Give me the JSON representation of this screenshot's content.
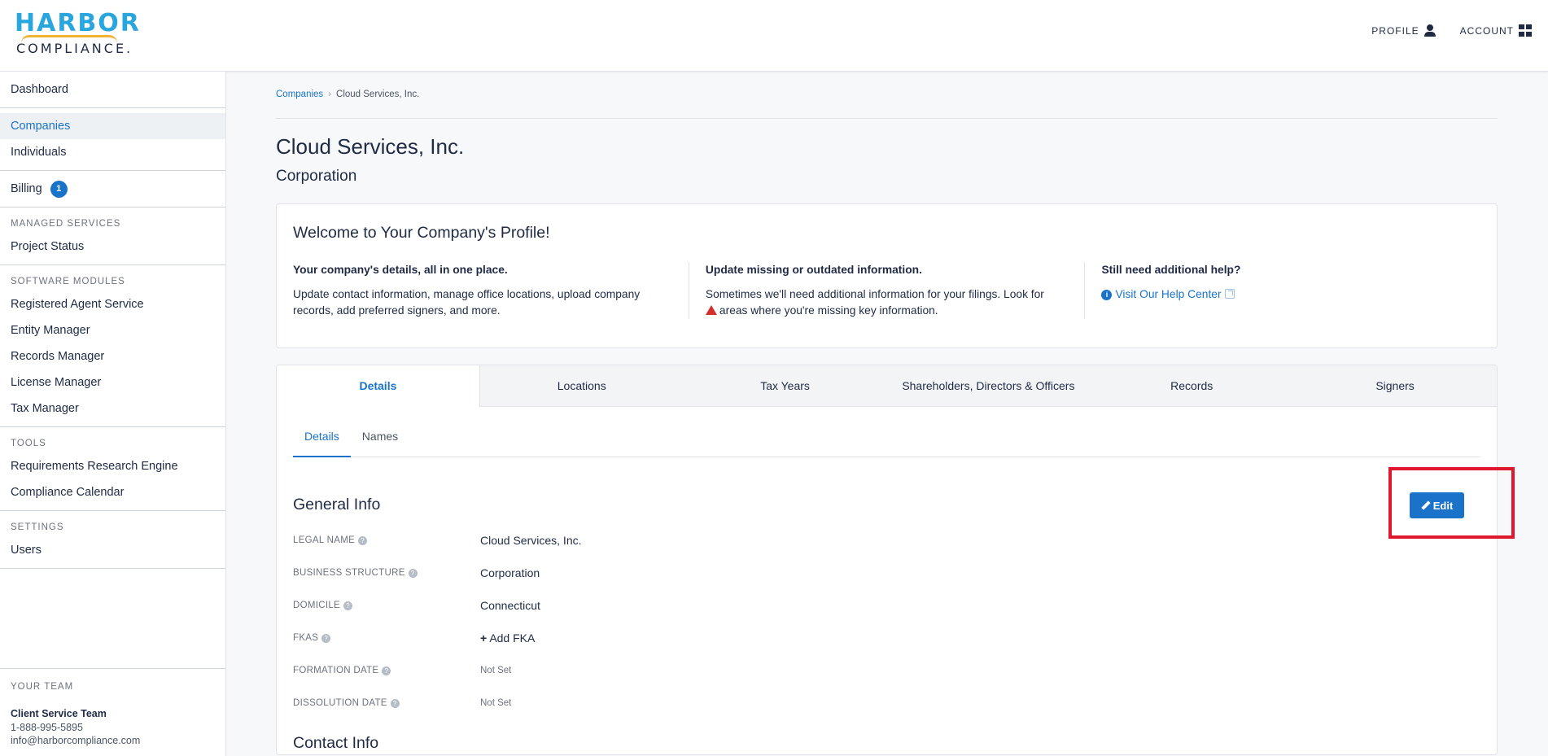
{
  "brand": {
    "line1": "HARBOR",
    "line2": "COMPLIANCE."
  },
  "topnav": {
    "profile": "PROFILE",
    "account": "ACCOUNT"
  },
  "sidebar": {
    "dashboard": "Dashboard",
    "companies": "Companies",
    "individuals": "Individuals",
    "billing": "Billing",
    "billing_badge": "1",
    "managed_services_head": "MANAGED SERVICES",
    "project_status": "Project Status",
    "software_modules_head": "SOFTWARE MODULES",
    "modules": [
      "Registered Agent Service",
      "Entity Manager",
      "Records Manager",
      "License Manager",
      "Tax Manager"
    ],
    "tools_head": "TOOLS",
    "tools": [
      "Requirements Research Engine",
      "Compliance Calendar"
    ],
    "settings_head": "SETTINGS",
    "users": "Users",
    "team": {
      "head": "YOUR TEAM",
      "name": "Client Service Team",
      "phone": "1-888-995-5895",
      "email": "info@harborcompliance.com"
    }
  },
  "breadcrumb": {
    "root": "Companies",
    "sep": "›",
    "current": "Cloud Services, Inc."
  },
  "page": {
    "title": "Cloud Services, Inc.",
    "subtitle": "Corporation"
  },
  "welcome": {
    "title": "Welcome to Your Company's Profile!",
    "col1_head": "Your company's details, all in one place.",
    "col1_body": "Update contact information, manage office locations, upload company records, add preferred signers, and more.",
    "col2_head": "Update missing or outdated information.",
    "col2_body_a": "Sometimes we'll need additional information for your filings. Look for",
    "col2_body_b": "areas where you're missing key information.",
    "col3_head": "Still need additional help?",
    "col3_link": "Visit Our Help Center"
  },
  "tabs": [
    "Details",
    "Locations",
    "Tax Years",
    "Shareholders, Directors & Officers",
    "Records",
    "Signers"
  ],
  "subtabs": [
    "Details",
    "Names"
  ],
  "general": {
    "title": "General Info",
    "edit": "Edit",
    "fields": [
      {
        "label": "LEGAL NAME",
        "value": "Cloud Services, Inc."
      },
      {
        "label": "BUSINESS STRUCTURE",
        "value": "Corporation"
      },
      {
        "label": "DOMICILE",
        "value": "Connecticut"
      },
      {
        "label": "FKAS",
        "value": "Add FKA"
      },
      {
        "label": "FORMATION DATE",
        "value": "Not Set"
      },
      {
        "label": "DISSOLUTION DATE",
        "value": "Not Set"
      }
    ],
    "next_section": "Contact Info"
  },
  "colors": {
    "accent": "#1a73c9",
    "highlight": "#e0182d",
    "warning": "#d32f2f"
  }
}
